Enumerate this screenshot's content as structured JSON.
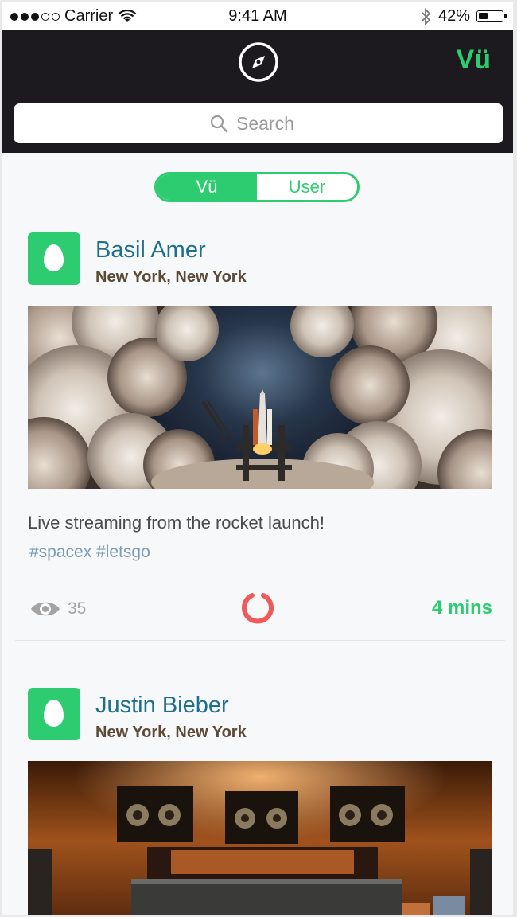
{
  "status_bar": {
    "carrier": "Carrier",
    "time": "9:41 AM",
    "battery": "42%",
    "battery_level": 0.42
  },
  "nav": {
    "brand": "Vü"
  },
  "search": {
    "placeholder": "Search"
  },
  "toggle": {
    "options": [
      "Vü",
      "User"
    ],
    "selected": "Vü"
  },
  "posts": [
    {
      "name": "Basil Amer",
      "location": "New York, New York",
      "caption": "Live streaming from the rocket launch!",
      "tags": "#spacex #letsgo",
      "views": "35",
      "time_ago": "4 mins"
    },
    {
      "name": "Justin Bieber",
      "location": "New York, New York"
    }
  ],
  "colors": {
    "accent": "#2ecc71",
    "nav_bg": "#1c1a1f",
    "username": "#1f6e8c",
    "live": "#f05a5a"
  }
}
